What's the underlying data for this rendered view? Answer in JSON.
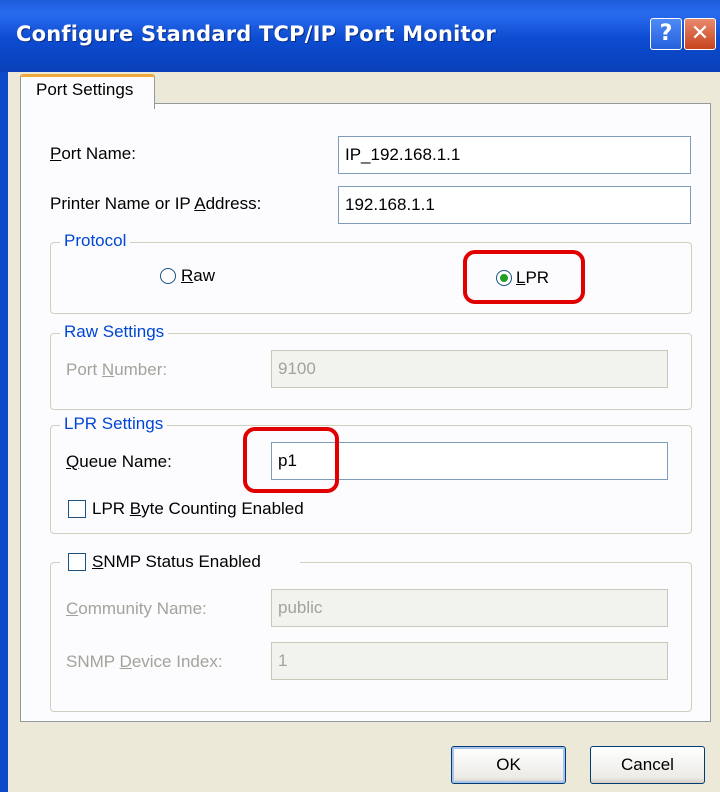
{
  "window": {
    "title": "Configure Standard TCP/IP Port Monitor",
    "help_glyph": "?",
    "close_glyph": "✕"
  },
  "tabs": [
    {
      "label": "Port Settings"
    }
  ],
  "fields": {
    "port_name": {
      "label_pre": "",
      "label_acc": "P",
      "label_post": "ort Name:",
      "value": "IP_192.168.1.1"
    },
    "printer_address": {
      "label_pre": "Printer Name or IP ",
      "label_acc": "A",
      "label_post": "ddress:",
      "value": "192.168.1.1"
    }
  },
  "protocol": {
    "title": "Protocol",
    "options": [
      {
        "acc": "R",
        "rest": "aw",
        "selected": false
      },
      {
        "acc": "L",
        "rest": "PR",
        "selected": true
      }
    ]
  },
  "raw_settings": {
    "title": "Raw Settings",
    "port_label_pre": "Port ",
    "port_label_acc": "N",
    "port_label_post": "umber:",
    "port_value": "9100"
  },
  "lpr_settings": {
    "title": "LPR Settings",
    "queue_label_acc": "Q",
    "queue_label_post": "ueue Name:",
    "queue_value": "p1",
    "byte_count_pre": "LPR ",
    "byte_count_acc": "B",
    "byte_count_post": "yte Counting Enabled",
    "byte_count_checked": false
  },
  "snmp": {
    "acc": "S",
    "rest": "NMP Status Enabled",
    "checked": false,
    "community_pre": "",
    "community_acc": "C",
    "community_post": "ommunity Name:",
    "community_value": "public",
    "device_pre": "SNMP ",
    "device_acc": "D",
    "device_post": "evice Index:",
    "device_value": "1"
  },
  "buttons": {
    "ok": "OK",
    "cancel": "Cancel"
  },
  "colors": {
    "title_bar": "#0c4bd0",
    "group_title": "#0046d5",
    "highlight": "#e00000",
    "tab_accent": "#f0a93c"
  }
}
